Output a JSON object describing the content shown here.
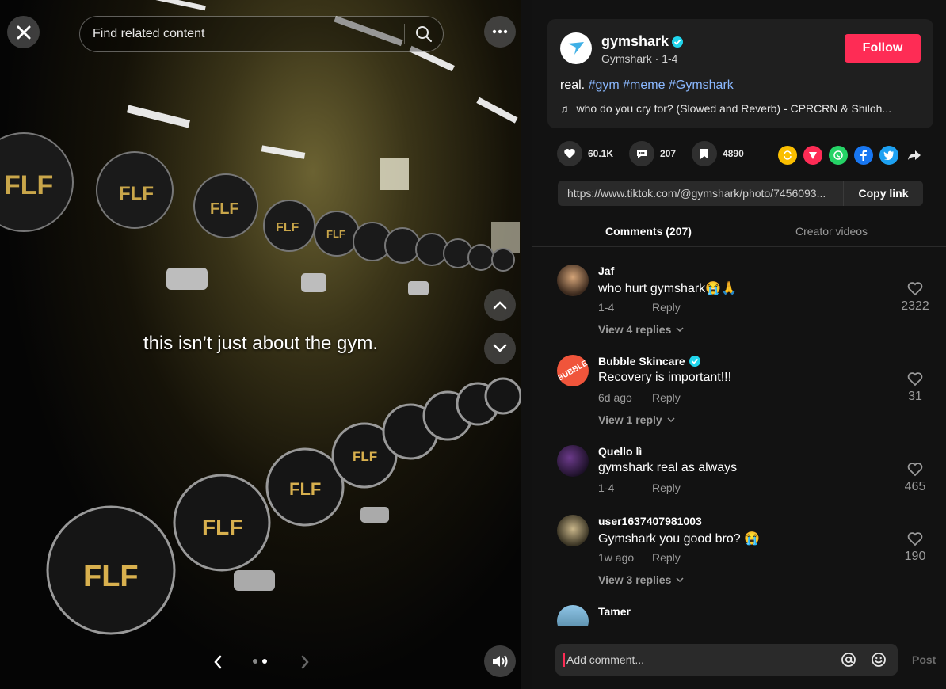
{
  "media": {
    "search_placeholder": "Find related content",
    "caption": "this isn’t just about the gym.",
    "carousel_total": 2,
    "carousel_active": 2
  },
  "post": {
    "author": "gymshark",
    "author_sub": "Gymshark · 1-4",
    "follow_label": "Follow",
    "desc_prefix": "real. ",
    "hashtags": [
      "#gym",
      "#meme",
      "#Gymshark"
    ],
    "music": "who do you cry for? (Slowed and Reverb) - CPRCRN & Shiloh...",
    "likes": "60.1K",
    "comments": "207",
    "saves": "4890",
    "link": "https://www.tiktok.com/@gymshark/photo/7456093...",
    "copy_label": "Copy link"
  },
  "tabs": [
    "Comments (207)",
    "Creator videos"
  ],
  "comments": [
    {
      "user": "Jaf",
      "verified": false,
      "text": "who hurt gymshark😭🙏",
      "date": "1-4",
      "reply": "Reply",
      "likes": "2322",
      "replies": "View 4 replies"
    },
    {
      "user": "Bubble Skincare",
      "verified": true,
      "text": "Recovery is important!!!",
      "date": "6d ago",
      "reply": "Reply",
      "likes": "31",
      "replies": "View 1 reply"
    },
    {
      "user": "Quello lì",
      "verified": false,
      "text": "gymshark real as always",
      "date": "1-4",
      "reply": "Reply",
      "likes": "465",
      "replies": ""
    },
    {
      "user": "user1637407981003",
      "verified": false,
      "text": "Gymshark you good bro? 😭",
      "date": "1w ago",
      "reply": "Reply",
      "likes": "190",
      "replies": "View 3 replies"
    },
    {
      "user": "Tamer",
      "verified": false,
      "text": "",
      "date": "",
      "reply": "",
      "likes": "",
      "replies": ""
    }
  ],
  "input": {
    "placeholder": "Add comment...",
    "post_label": "Post"
  },
  "colors": {
    "accent": "#fe2c55",
    "hashtag": "#8ab8ff",
    "verified": "#20d5ec"
  }
}
